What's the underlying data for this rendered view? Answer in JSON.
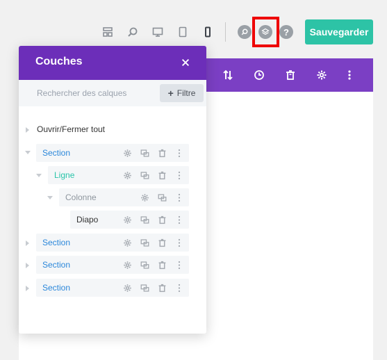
{
  "toolbar": {
    "view_icons": [
      "wireframe-icon",
      "zoom-icon",
      "desktop-icon",
      "tablet-icon",
      "phone-icon"
    ],
    "save_label": "Sauvegarder",
    "help_label": "?"
  },
  "builder_bar": {
    "icons": [
      "sort-icon",
      "history-icon",
      "trash-icon",
      "gear-icon",
      "more-icon"
    ]
  },
  "layers_panel": {
    "title": "Couches",
    "search": {
      "placeholder": "Rechercher des calques",
      "value": ""
    },
    "filter_label": "Filtre",
    "toggle_all_label": "Ouvrir/Fermer tout",
    "items": [
      {
        "label": "Section",
        "type": "section",
        "expanded": true
      },
      {
        "label": "Ligne",
        "type": "row",
        "expanded": true
      },
      {
        "label": "Colonne",
        "type": "column",
        "expanded": true
      },
      {
        "label": "Diapo",
        "type": "module"
      },
      {
        "label": "Section",
        "type": "section",
        "expanded": false
      },
      {
        "label": "Section",
        "type": "section",
        "expanded": false
      },
      {
        "label": "Section",
        "type": "section",
        "expanded": false
      }
    ]
  },
  "colors": {
    "purple_bar": "#7b3fc4",
    "panel_header": "#6c2eb9",
    "save_button": "#2dc3a6",
    "section_label": "#2b87da",
    "row_label": "#29c4a9",
    "highlight": "#ee0000"
  }
}
